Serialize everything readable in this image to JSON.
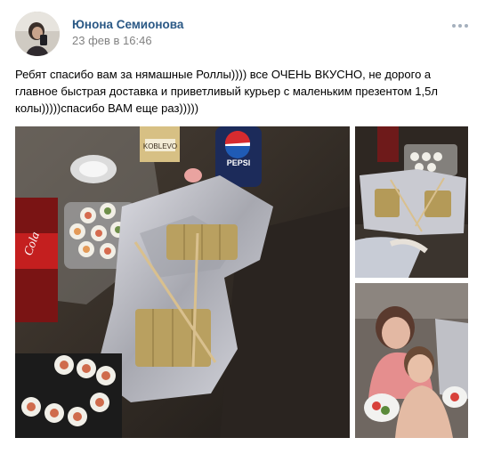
{
  "post": {
    "author": "Юнона Семионова",
    "timestamp": "23 фев в 16:46",
    "text": "Ребят спасибо вам за нямашные Роллы)))) все ОЧЕНЬ ВКУСНО, не дорого а главное быстрая доставка и приветливый курьер с маленьким презентом 1,5л колы)))))спасибо ВАМ еще раз)))))",
    "menu_icon": "more-horizontal-icon"
  },
  "photos": [
    {
      "name": "photo-rolls-table",
      "label_pepsi": "PEPSI",
      "label_koblevo": "KOBLEVO",
      "label_cola": "Cola"
    },
    {
      "name": "photo-rolls-foil"
    },
    {
      "name": "photo-selfie"
    }
  ],
  "colors": {
    "author_link": "#2a5885",
    "timestamp": "#828282",
    "text": "#000000",
    "background": "#ffffff"
  }
}
